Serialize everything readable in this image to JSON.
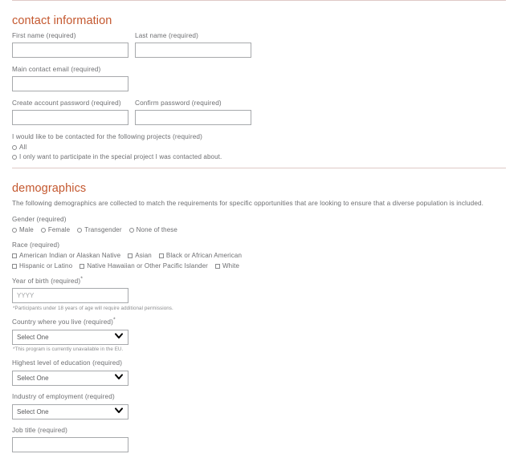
{
  "contact_section": {
    "title": "contact information",
    "fields": {
      "first_name": {
        "label": "First name (required)",
        "value": "",
        "placeholder": ""
      },
      "last_name": {
        "label": "Last name (required)",
        "value": "",
        "placeholder": ""
      },
      "email": {
        "label": "Main contact email (required)",
        "value": "",
        "placeholder": ""
      },
      "create_password": {
        "label": "Create account password (required)",
        "value": "",
        "placeholder": ""
      },
      "confirm_password": {
        "label": "Confirm password (required)",
        "value": "",
        "placeholder": ""
      }
    },
    "contact_preference": {
      "label": "I would like to be contacted for the following projects (required)",
      "options": [
        "All",
        "I only want to participate in the special project I was contacted about."
      ]
    }
  },
  "demographics_section": {
    "title": "demographics",
    "intro": "The following demographics are collected to match the requirements for specific opportunities that are looking to ensure that a diverse population is included.",
    "gender": {
      "label": "Gender (required)",
      "options": [
        "Male",
        "Female",
        "Transgender",
        "None of these"
      ]
    },
    "race": {
      "label": "Race (required)",
      "options_row1": [
        "American Indian or Alaskan Native",
        "Asian",
        "Black or African American"
      ],
      "options_row2": [
        "Hispanic or Latino",
        "Native Hawaiian or Other Pacific Islander",
        "White"
      ]
    },
    "year_of_birth": {
      "label": "Year of birth (required)",
      "star": "*",
      "placeholder": "YYYY",
      "value": "",
      "footnote": "*Participants under 18 years of age will require additional permissions."
    },
    "country": {
      "label": "Country where you live (required)",
      "star": "*",
      "selected": "Select One",
      "footnote": "*This program is currently unavailable in the EU."
    },
    "education": {
      "label": "Highest level of education (required)",
      "selected": "Select One"
    },
    "industry": {
      "label": "Industry of employment (required)",
      "selected": "Select One"
    },
    "job_title": {
      "label": "Job title (required)",
      "value": "",
      "placeholder": ""
    }
  },
  "colors": {
    "heading": "#c4582f",
    "divider": "#dfc9c6",
    "label_text": "#6d6e71",
    "input_border": "#a7a9ac"
  }
}
